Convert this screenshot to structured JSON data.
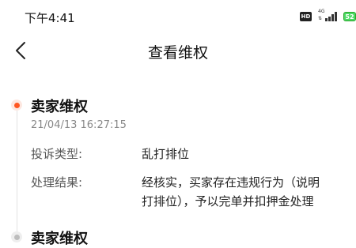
{
  "status_bar": {
    "time": "下午4:41",
    "hd_label": "HD",
    "network_label": "4G",
    "battery_label": "52"
  },
  "nav": {
    "title": "查看维权",
    "back_icon": "chevron-left-icon"
  },
  "entries": [
    {
      "title": "卖家维权",
      "time": "21/04/13 16:27:15",
      "fields": [
        {
          "label": "投诉类型:",
          "value": "乱打排位"
        },
        {
          "label": "处理结果:",
          "value_lines": [
            "经核实，买家存在违规行为（说明",
            "打排位），予以完单并扣押金处理"
          ]
        }
      ]
    },
    {
      "title": "卖家维权"
    }
  ],
  "colors": {
    "accent": "#ff5722",
    "dot_ring": "#fde7e0",
    "timeline_line": "#e2e2e2",
    "secondary_text": "#888888"
  }
}
